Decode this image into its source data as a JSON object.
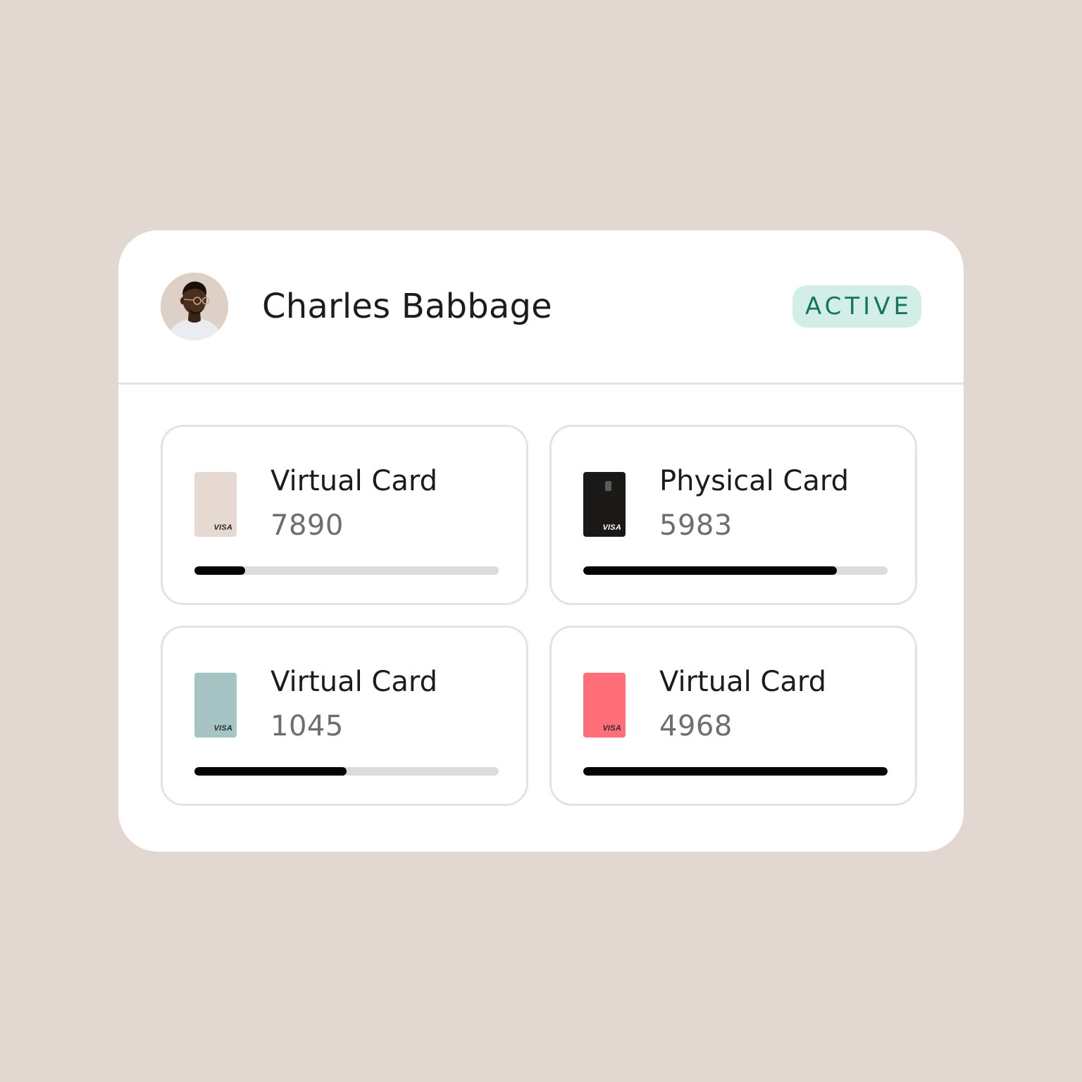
{
  "user": {
    "name": "Charles Babbage",
    "status": "ACTIVE"
  },
  "colors": {
    "background": "#e3d8d1",
    "status_bg": "#d2eee7",
    "status_text": "#16735f",
    "progress_fill": "#050505",
    "progress_track": "#dcdcdc"
  },
  "cards": [
    {
      "type": "Virtual Card",
      "number": "7890",
      "brand": "VISA",
      "card_color": "#e6d9d2",
      "brand_color": "#2a2a2a",
      "has_chip": false,
      "progress": 0.166
    },
    {
      "type": "Physical Card",
      "number": "5983",
      "brand": "VISA",
      "card_color": "#1b1918",
      "brand_color": "#ffffff",
      "has_chip": true,
      "progress": 0.833
    },
    {
      "type": "Virtual Card",
      "number": "1045",
      "brand": "VISA",
      "card_color": "#a6c4c3",
      "brand_color": "#2a2a2a",
      "has_chip": false,
      "progress": 0.5
    },
    {
      "type": "Virtual Card",
      "number": "4968",
      "brand": "VISA",
      "card_color": "#ff6f79",
      "brand_color": "#2a2a2a",
      "has_chip": false,
      "progress": 1.0
    }
  ]
}
